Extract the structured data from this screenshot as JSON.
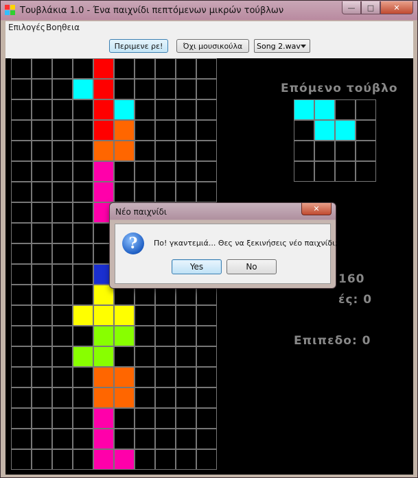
{
  "window": {
    "title": "Τουβλάκια 1.0 - Ένα παιχνίδι πεπτόμενων μικρών τούβλων",
    "icon": "app-blocks-icon",
    "controls": {
      "minimize": "—",
      "maximize": "□",
      "close": "✕"
    }
  },
  "menu": {
    "options": "Επιλογές",
    "help": "Βοηθεια"
  },
  "toolbar": {
    "pause_label": "Περιμενε ρε!",
    "music_label": "Όχι μουσικούλα",
    "song_selected": "Song 2.wav"
  },
  "colors": {
    "red": "#ff0000",
    "cyan": "#00ffff",
    "orange": "#ff6600",
    "magenta": "#ff00aa",
    "blue": "#1a2fd0",
    "yellow": "#ffff00",
    "green": "#88ff00",
    "grid": "#777777"
  },
  "board": {
    "columns": 10,
    "rows": 20,
    "blocks": [
      {
        "row": 0,
        "col": 4,
        "color": "red"
      },
      {
        "row": 1,
        "col": 3,
        "color": "cyan"
      },
      {
        "row": 1,
        "col": 4,
        "color": "red"
      },
      {
        "row": 2,
        "col": 4,
        "color": "red"
      },
      {
        "row": 2,
        "col": 5,
        "color": "cyan"
      },
      {
        "row": 3,
        "col": 4,
        "color": "red"
      },
      {
        "row": 3,
        "col": 5,
        "color": "orange"
      },
      {
        "row": 4,
        "col": 4,
        "color": "orange"
      },
      {
        "row": 4,
        "col": 5,
        "color": "orange"
      },
      {
        "row": 5,
        "col": 4,
        "color": "magenta"
      },
      {
        "row": 6,
        "col": 4,
        "color": "magenta"
      },
      {
        "row": 7,
        "col": 4,
        "color": "magenta"
      },
      {
        "row": 10,
        "col": 4,
        "color": "blue"
      },
      {
        "row": 11,
        "col": 4,
        "color": "yellow"
      },
      {
        "row": 12,
        "col": 3,
        "color": "yellow"
      },
      {
        "row": 12,
        "col": 4,
        "color": "yellow"
      },
      {
        "row": 12,
        "col": 5,
        "color": "yellow"
      },
      {
        "row": 13,
        "col": 4,
        "color": "green"
      },
      {
        "row": 13,
        "col": 5,
        "color": "green"
      },
      {
        "row": 14,
        "col": 3,
        "color": "green"
      },
      {
        "row": 14,
        "col": 4,
        "color": "green"
      },
      {
        "row": 15,
        "col": 4,
        "color": "orange"
      },
      {
        "row": 15,
        "col": 5,
        "color": "orange"
      },
      {
        "row": 16,
        "col": 4,
        "color": "orange"
      },
      {
        "row": 16,
        "col": 5,
        "color": "orange"
      },
      {
        "row": 17,
        "col": 4,
        "color": "magenta"
      },
      {
        "row": 18,
        "col": 4,
        "color": "magenta"
      },
      {
        "row": 19,
        "col": 4,
        "color": "magenta"
      },
      {
        "row": 19,
        "col": 5,
        "color": "magenta"
      }
    ]
  },
  "next_piece": {
    "label": "Επόμενο τούβλο",
    "columns": 4,
    "rows": 4,
    "blocks": [
      {
        "row": 0,
        "col": 0,
        "color": "cyan"
      },
      {
        "row": 0,
        "col": 1,
        "color": "cyan"
      },
      {
        "row": 1,
        "col": 1,
        "color": "cyan"
      },
      {
        "row": 1,
        "col": 2,
        "color": "cyan"
      }
    ]
  },
  "stats": {
    "score_visible": "160",
    "lines_visible": "ές: 0",
    "level": "Επιπεδο: 0"
  },
  "dialog": {
    "title": "Νέο παιχνίδι",
    "icon": "question-icon",
    "message": "Πο! γκαντεμιά... Θες να ξεκινήσεις νέο παιχνίδι;",
    "yes_label": "Yes",
    "no_label": "No"
  }
}
